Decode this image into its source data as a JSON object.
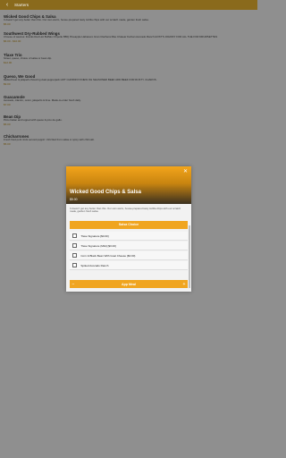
{
  "header": {
    "back_icon": "back-arrow-icon",
    "title": "Starters"
  },
  "menu": {
    "items": [
      {
        "name": "Wicked Good Chips & Salsa",
        "desc": "It doesn't get any better than this. Our own warm, house-prepared tasty tortilla chips with our scratch made, garden fresh salsa.",
        "price": "$5.00"
      },
      {
        "name": "Southwest Dry-Rubbed Wings",
        "desc": "Choose of sauces: Franks Red Hot Buffalo Chipotle BBQ Pineapple Habanero Gran Clachera Mau Chatear Korban Avocado Ranch HOST'S JOHNNY FOR ALL THE FOR DRUMSETTES",
        "price": "$6.00 - $10.00"
      },
      {
        "name": "Tlaxe Trio",
        "desc": "Street, queso, choice of salsa or bean dip.",
        "price": "$12.00"
      },
      {
        "name": "Queso, We Good",
        "desc": "Melted beer & jalapeño flavoring dual-pepperjack HOT CHORIZO! KNEW OH SEASONED BEEF ADD BEEF FOR RUSTY. CHAROS.",
        "price": "$9.00"
      },
      {
        "name": "Guacamole",
        "desc": "Avocado, cilantro, onion, jalapeño & lime. Made-to-order fresh daily.",
        "price": "$7.00"
      },
      {
        "name": "Bean Dip",
        "desc": "Pinto Italian and topped with queso & pico de gallo.",
        "price": "$5.00"
      },
      {
        "name": "Chicharrones",
        "desc": "Fresh fried pork rinds served poppin'. Drizzled from salsa or spicy with chili salt.",
        "price": "$5.00"
      }
    ]
  },
  "modal": {
    "close_icon": "close-icon",
    "title": "Wicked Good Chips & Salsa",
    "price": "$5.00",
    "desc": "It doesn't get any better than this. Our own warm, house-prepared tasty tortilla chips with our scratch made, garden fresh salsa.",
    "section_label": "Salsa Choice",
    "options": [
      "Tlaxe Signature [$0.00]",
      "Tlaxe Signature (Mild) [$0.00]",
      "Corn & Black Bean With Goat Cheese ($0.00)",
      "Spiked Avocado Ranch"
    ],
    "add_button": "App Meal",
    "minus_icon": "minus-icon",
    "plus_icon": "plus-icon"
  }
}
